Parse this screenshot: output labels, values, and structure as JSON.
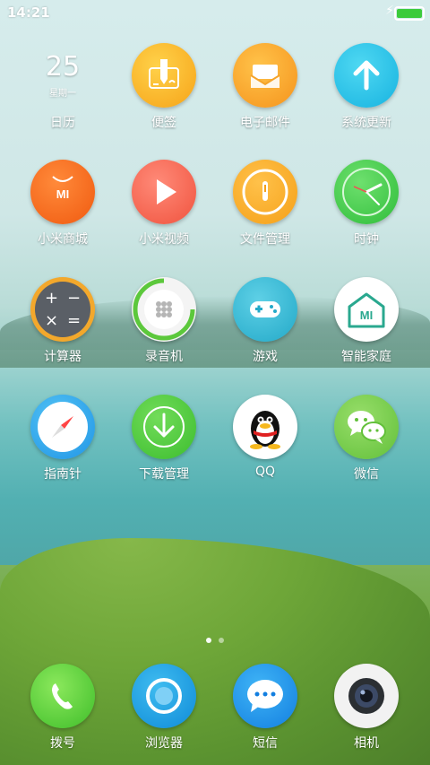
{
  "status_bar": {
    "time": "14:21",
    "charging_icon": "lightning-icon",
    "battery_color": "#3ccb3c"
  },
  "calendar": {
    "day": "25",
    "weekday": "星期一"
  },
  "apps": [
    {
      "label": "日历"
    },
    {
      "label": "便签"
    },
    {
      "label": "电子邮件"
    },
    {
      "label": "系统更新"
    },
    {
      "label": "小米商城"
    },
    {
      "label": "小米视频"
    },
    {
      "label": "文件管理"
    },
    {
      "label": "时钟"
    },
    {
      "label": "计算器"
    },
    {
      "label": "录音机"
    },
    {
      "label": "游戏"
    },
    {
      "label": "智能家庭"
    },
    {
      "label": "指南针"
    },
    {
      "label": "下载管理"
    },
    {
      "label": "QQ"
    },
    {
      "label": "微信"
    }
  ],
  "dock": [
    {
      "label": "拨号"
    },
    {
      "label": "浏览器"
    },
    {
      "label": "短信"
    },
    {
      "label": "相机"
    }
  ],
  "mi_logo_text": "MI",
  "calc_symbols": [
    "+",
    "−",
    "×",
    "="
  ],
  "page_indicator": {
    "pages": 2,
    "current": 1
  }
}
